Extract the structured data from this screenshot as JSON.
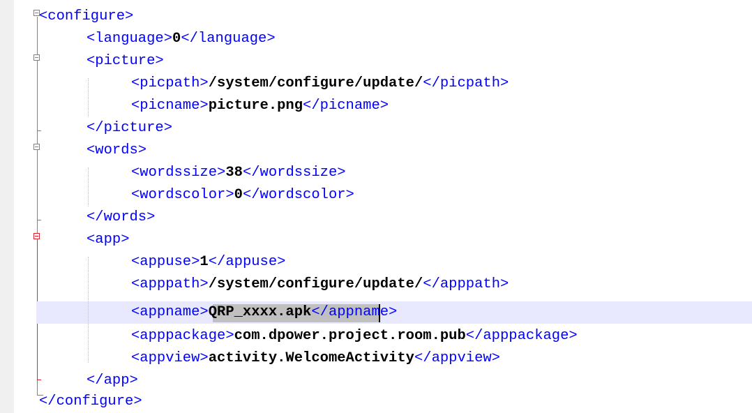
{
  "editor": {
    "lines": [
      {
        "indent": 0,
        "open": "<configure>",
        "value": "",
        "close": ""
      },
      {
        "indent": 1,
        "open": "<language>",
        "value": "0",
        "close": "</language>"
      },
      {
        "indent": 1,
        "open": "<picture>",
        "value": "",
        "close": ""
      },
      {
        "indent": 2,
        "open": "<picpath>",
        "value": "/system/configure/update/",
        "close": "</picpath>"
      },
      {
        "indent": 2,
        "open": "<picname>",
        "value": "picture.png",
        "close": "</picname>"
      },
      {
        "indent": 1,
        "open": "",
        "value": "",
        "close": "</picture>"
      },
      {
        "indent": 1,
        "open": "<words>",
        "value": "",
        "close": ""
      },
      {
        "indent": 2,
        "open": "<wordssize>",
        "value": "38",
        "close": "</wordssize>"
      },
      {
        "indent": 2,
        "open": "<wordscolor>",
        "value": "0",
        "close": "</wordscolor>"
      },
      {
        "indent": 1,
        "open": "",
        "value": "",
        "close": "</words>"
      },
      {
        "indent": 1,
        "open": "<app>",
        "value": "",
        "close": ""
      },
      {
        "indent": 2,
        "open": "<appuse>",
        "value": "1",
        "close": "</appuse>"
      },
      {
        "indent": 2,
        "open": "<apppath>",
        "value": "/system/configure/update/",
        "close": "</apppath>"
      },
      {
        "indent": 2,
        "open": "<appname>",
        "value": "QRP_xxxx.apk",
        "close": "</appname>"
      },
      {
        "indent": 2,
        "open": "<apppackage>",
        "value": "com.dpower.project.room.pub",
        "close": "</apppackage>"
      },
      {
        "indent": 2,
        "open": "<appview>",
        "value": "activity.WelcomeActivity",
        "close": "</appview>"
      },
      {
        "indent": 1,
        "open": "",
        "value": "",
        "close": "</app>"
      },
      {
        "indent": 0,
        "open": "",
        "value": "",
        "close": "</configure>"
      }
    ],
    "current_line": 13,
    "selected_text": "QRP_xxxx.apk"
  },
  "colors": {
    "tag": "#0000ff",
    "value": "#000000",
    "background": "#ffffff",
    "margin": "#f0f0f0",
    "current_line": "#e8e8ff",
    "selection": "#c0c0c0",
    "active_fold": "#e0202a",
    "fold_marker": "#808080"
  }
}
